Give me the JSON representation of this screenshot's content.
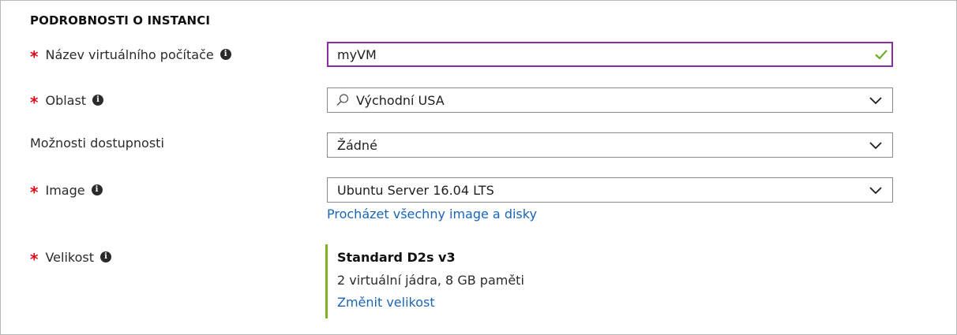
{
  "section": {
    "title": "PODROBNOSTI O INSTANCI"
  },
  "fields": {
    "vm_name": {
      "label": "Název virtuálního počítače",
      "required": "*",
      "value": "myVM"
    },
    "region": {
      "label": "Oblast",
      "required": "*",
      "value": "Východní USA"
    },
    "availability": {
      "label": "Možnosti dostupnosti",
      "value": "Žádné"
    },
    "image": {
      "label": "Image",
      "required": "*",
      "value": "Ubuntu Server 16.04 LTS",
      "browse_link": "Procházet všechny image a disky"
    },
    "size": {
      "label": "Velikost",
      "required": "*",
      "name": "Standard D2s v3",
      "description": "2 virtuální jádra, 8 GB paměti",
      "change_link": "Změnit velikost"
    }
  },
  "icons": {
    "info": "info-icon",
    "chevron": "chevron-down-icon",
    "check": "checkmark-icon",
    "search": "search-icon"
  },
  "colors": {
    "required": "#e00b1c",
    "focus_border": "#8a2da5",
    "valid_check": "#6bab29",
    "link": "#1a65b8",
    "size_accent": "#7fb421"
  }
}
